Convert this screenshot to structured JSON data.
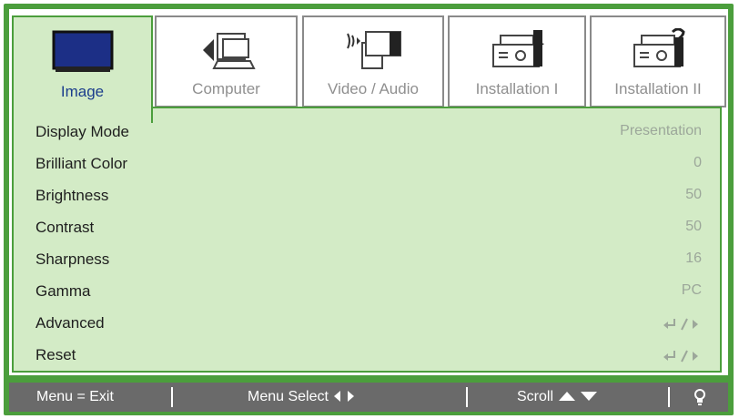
{
  "tabs": [
    {
      "label": "Image",
      "icon": "monitor-icon",
      "active": true
    },
    {
      "label": "Computer",
      "icon": "computer-icon",
      "active": false
    },
    {
      "label": "Video / Audio",
      "icon": "video-audio-icon",
      "active": false
    },
    {
      "label": "Installation I",
      "icon": "projector-1-icon",
      "active": false
    },
    {
      "label": "Installation II",
      "icon": "projector-2-icon",
      "active": false
    }
  ],
  "menu": [
    {
      "label": "Display Mode",
      "value": "Presentation"
    },
    {
      "label": "Brilliant Color",
      "value": "0"
    },
    {
      "label": "Brightness",
      "value": "50"
    },
    {
      "label": "Contrast",
      "value": "50"
    },
    {
      "label": "Sharpness",
      "value": "16"
    },
    {
      "label": "Gamma",
      "value": "PC"
    },
    {
      "label": "Advanced",
      "value_icon": "enter-arrow-icon"
    },
    {
      "label": "Reset",
      "value_icon": "enter-arrow-icon"
    }
  ],
  "footer": {
    "exit": "Menu = Exit",
    "select": "Menu Select",
    "scroll": "Scroll"
  },
  "colors": {
    "frame": "#4b9e3c",
    "panel": "#d3ebc6",
    "active_label": "#1b3d8c",
    "footer": "#6a6a6a"
  }
}
